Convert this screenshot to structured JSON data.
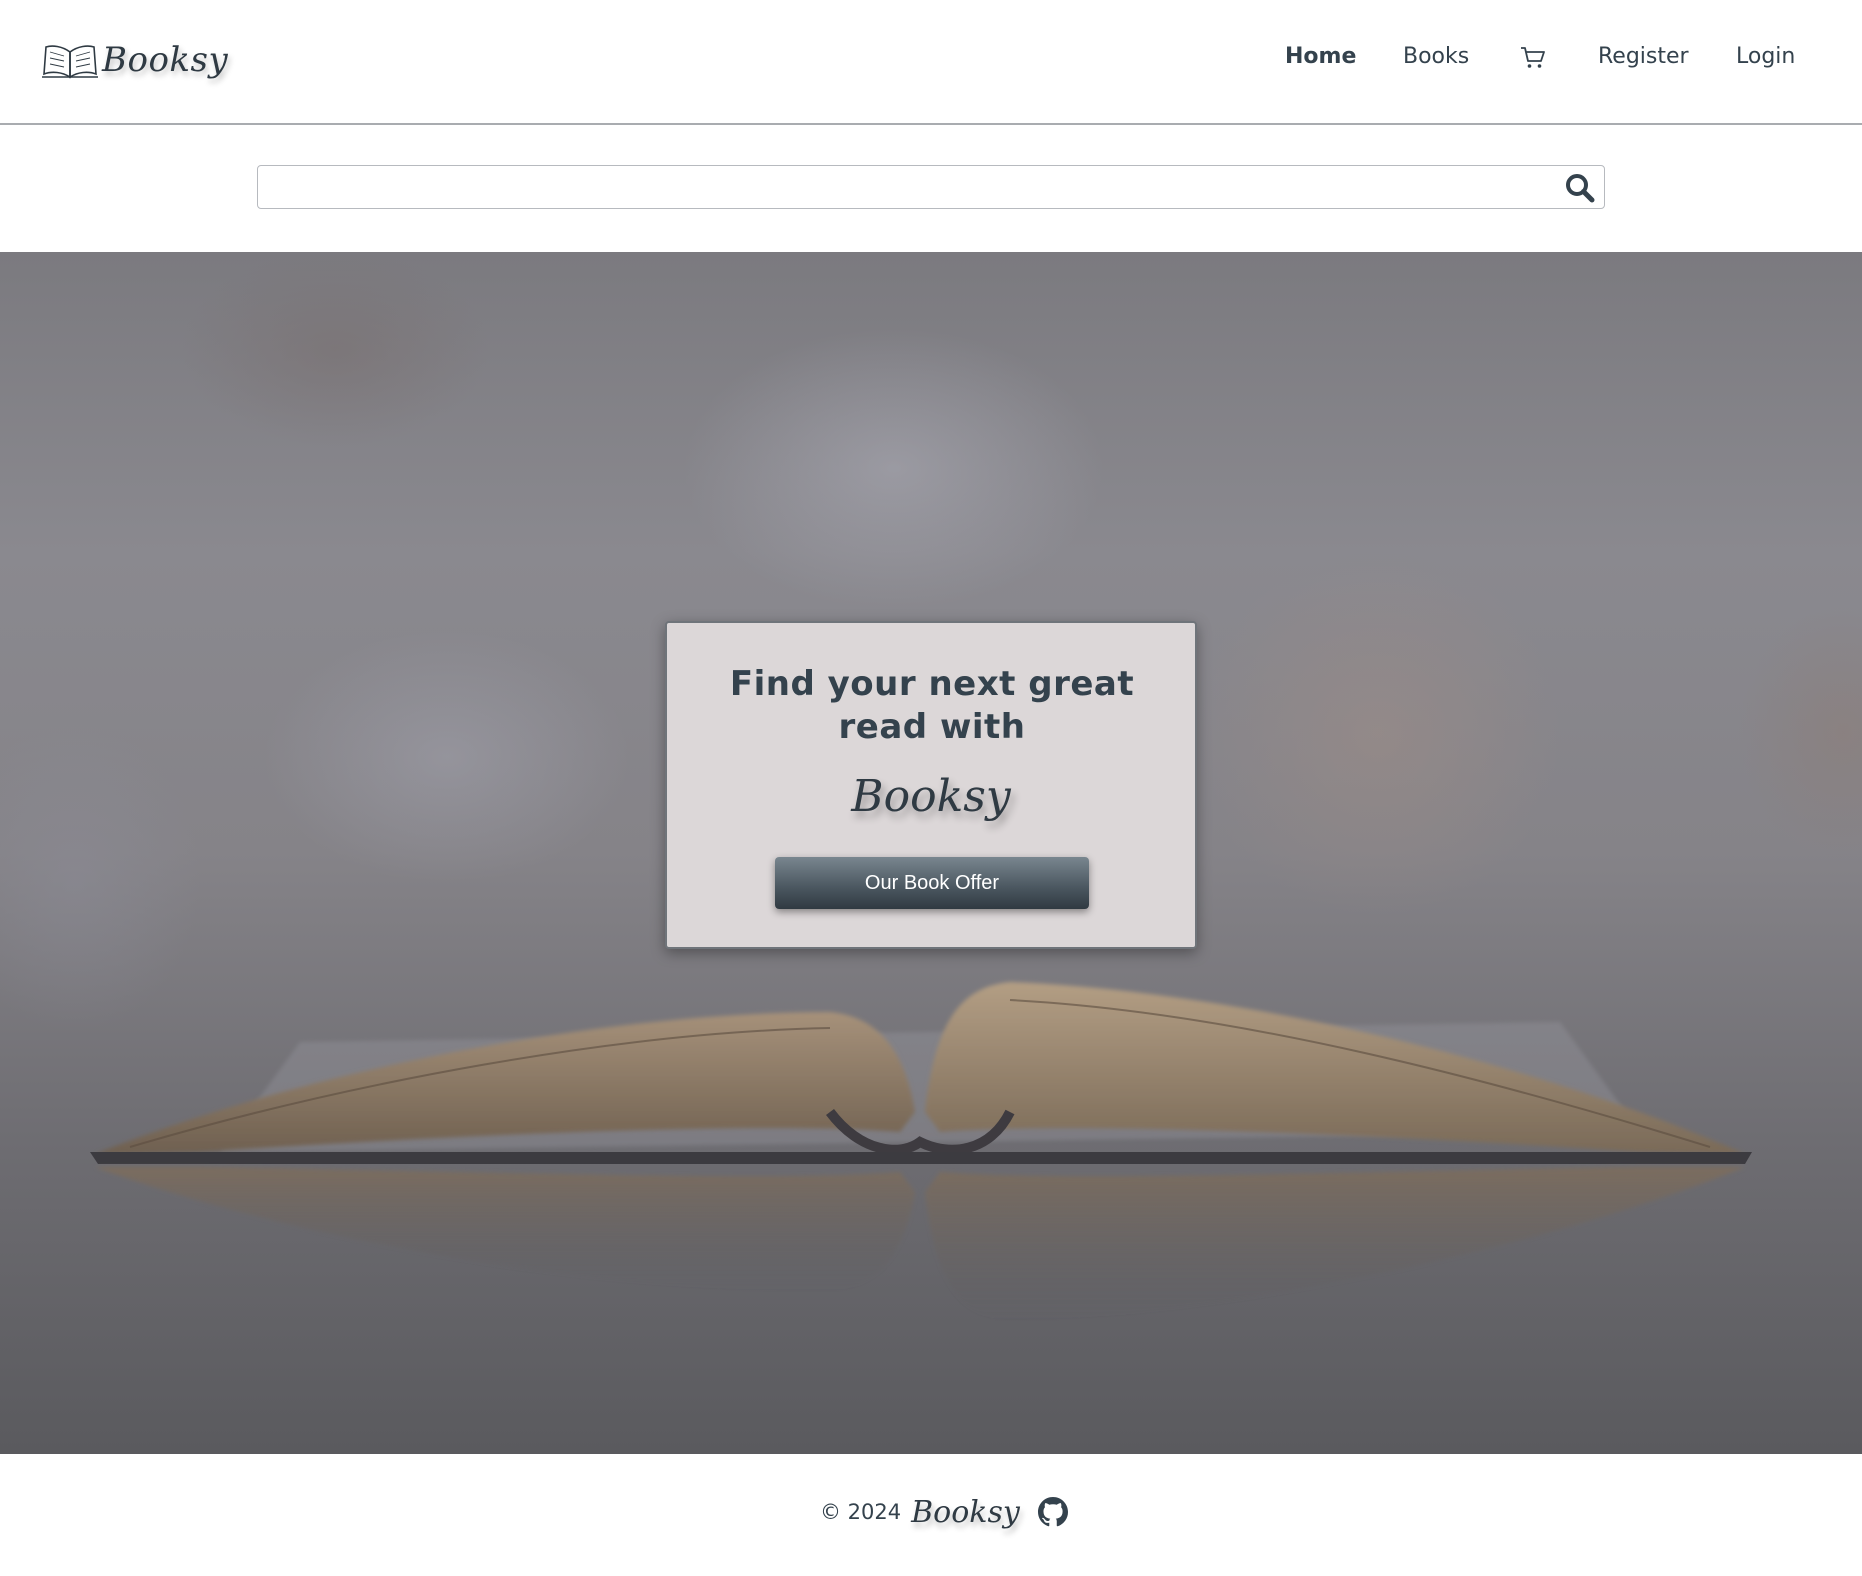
{
  "header": {
    "brand": "Booksy",
    "nav": {
      "home": "Home",
      "books": "Books",
      "register": "Register",
      "login": "Login"
    }
  },
  "icons": {
    "logo": "open-book-icon",
    "cart": "cart-icon",
    "search": "search-icon",
    "github": "github-icon"
  },
  "search": {
    "value": "",
    "placeholder": ""
  },
  "hero": {
    "heading": "Find your next great read with",
    "brand": "Booksy",
    "button_label": "Our Book Offer"
  },
  "footer": {
    "copyright": "© 2024",
    "brand": "Booksy"
  },
  "colors": {
    "text": "#34424d",
    "card_bg": "#dcd7d8",
    "button_top": "#79868f",
    "button_bottom": "#303a42"
  }
}
